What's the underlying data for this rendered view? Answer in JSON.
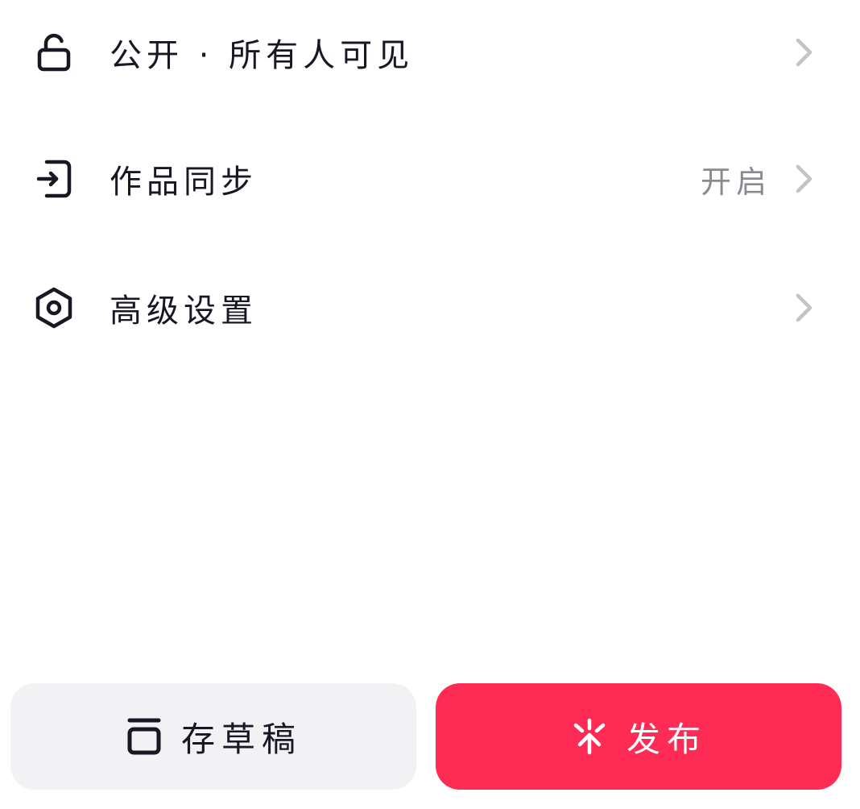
{
  "settings": {
    "privacy": {
      "label": "公开 · 所有人可见",
      "icon": "unlock-icon"
    },
    "sync": {
      "label": "作品同步",
      "value": "开启",
      "icon": "sync-login-icon"
    },
    "advanced": {
      "label": "高级设置",
      "icon": "hexagon-settings-icon"
    }
  },
  "actions": {
    "draft_label": "存草稿",
    "publish_label": "发布"
  },
  "colors": {
    "primary": "#fe2c55",
    "text": "#161823",
    "secondary_text": "#8a8b91",
    "draft_bg": "#f2f2f4"
  }
}
